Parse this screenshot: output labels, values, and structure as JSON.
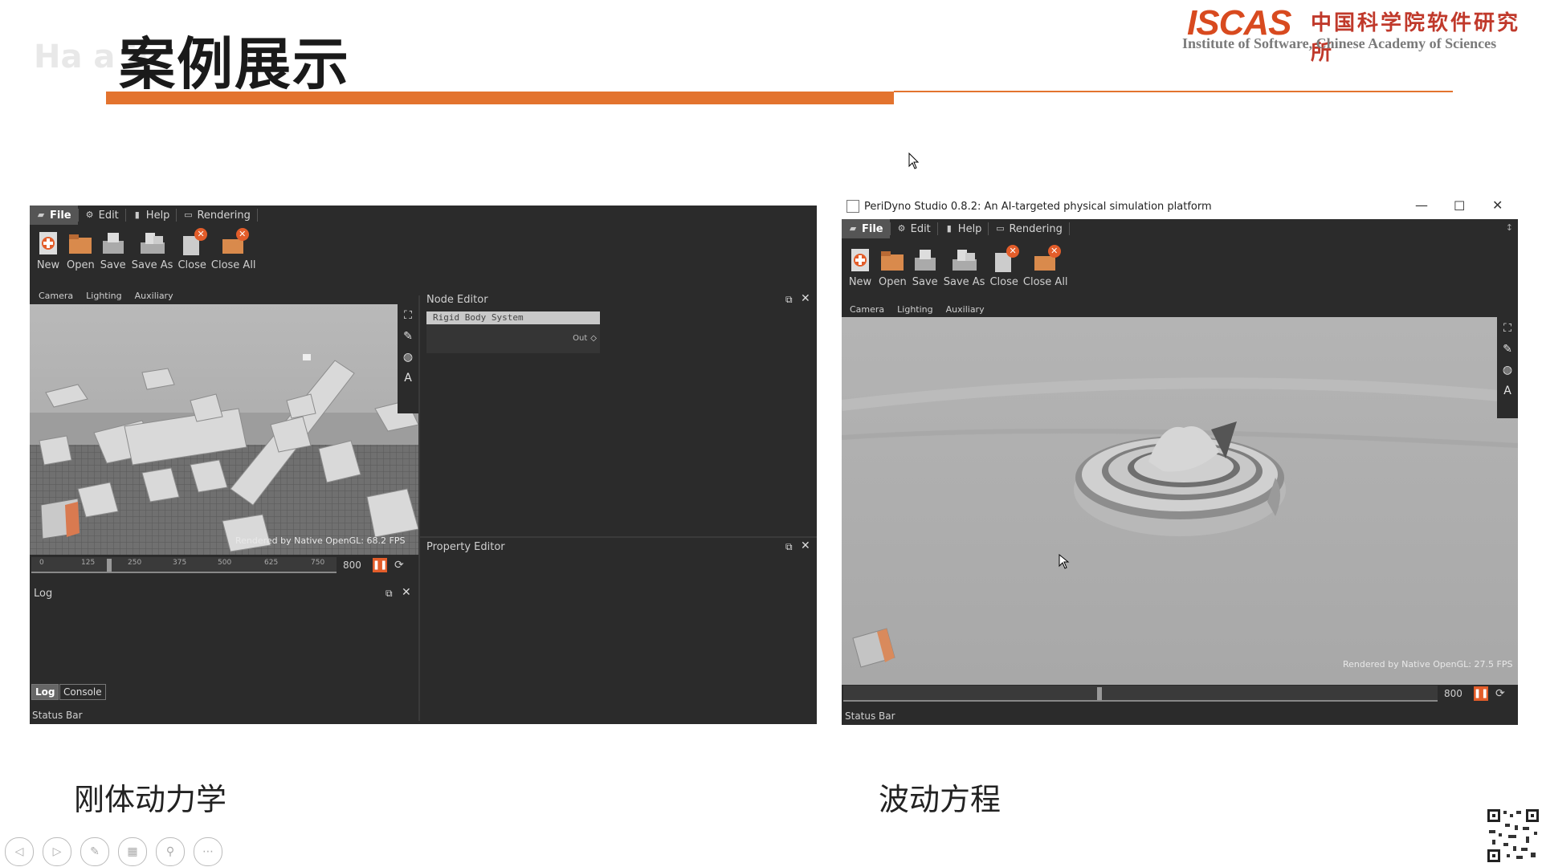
{
  "slide": {
    "title": "案例展示",
    "title_ghost": "Ha a il",
    "logo": {
      "mark": "ISCAS",
      "cn": "中国科学院软件研究所",
      "en": "Institute of Software, Chinese Academy of Sciences"
    },
    "caption_left": "刚体动力学",
    "caption_right": "波动方程",
    "accent_color": "#e3732e"
  },
  "app_left": {
    "menu": [
      {
        "label": "File",
        "icon": "folder-icon"
      },
      {
        "label": "Edit",
        "icon": "gear-icon"
      },
      {
        "label": "Help",
        "icon": "book-icon"
      },
      {
        "label": "Rendering",
        "icon": "monitor-icon"
      }
    ],
    "toolbar": [
      "New",
      "Open",
      "Save",
      "Save As",
      "Close",
      "Close All"
    ],
    "tabs": [
      "Camera",
      "Lighting",
      "Auxiliary"
    ],
    "fps_text": "Rendered by Native OpenGL: 68.2 FPS",
    "timeline": {
      "ticks": [
        "0",
        "125",
        "250",
        "375",
        "500",
        "625",
        "750"
      ],
      "total": "800",
      "position_fraction": 0.25
    },
    "node_editor": {
      "title": "Node Editor",
      "node_label": "Rigid Body System",
      "port_label": "Out"
    },
    "property_editor": {
      "title": "Property Editor"
    },
    "log": {
      "title": "Log",
      "tabs": [
        "Log",
        "Console"
      ]
    },
    "status": "Status Bar"
  },
  "app_right": {
    "window_title": "PeriDyno Studio 0.8.2:  An AI-targeted physical simulation platform",
    "menu": [
      {
        "label": "File",
        "icon": "folder-icon"
      },
      {
        "label": "Edit",
        "icon": "gear-icon"
      },
      {
        "label": "Help",
        "icon": "book-icon"
      },
      {
        "label": "Rendering",
        "icon": "monitor-icon"
      }
    ],
    "toolbar": [
      "New",
      "Open",
      "Save",
      "Save As",
      "Close",
      "Close All"
    ],
    "tabs": [
      "Camera",
      "Lighting",
      "Auxiliary"
    ],
    "fps_text": "Rendered by Native OpenGL: 27.5 FPS",
    "timeline": {
      "total": "800",
      "position_fraction": 0.43
    },
    "status": "Status Bar"
  }
}
